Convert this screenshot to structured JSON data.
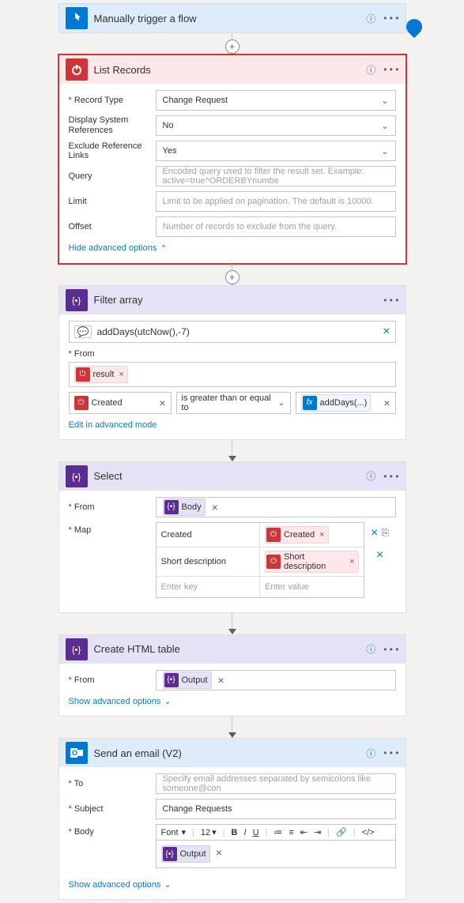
{
  "trigger": {
    "title": "Manually trigger a flow"
  },
  "listRecords": {
    "title": "List Records",
    "fields": {
      "recordType": {
        "label": "Record Type",
        "value": "Change Request"
      },
      "displaySystemRefs": {
        "label": "Display System References",
        "value": "No"
      },
      "excludeRefLinks": {
        "label": "Exclude Reference Links",
        "value": "Yes"
      },
      "query": {
        "label": "Query",
        "placeholder": "Encoded query used to filter the result set. Example: active=true^ORDERBYnumbe"
      },
      "limit": {
        "label": "Limit",
        "placeholder": "Limit to be applied on pagination. The default is 10000."
      },
      "offset": {
        "label": "Offset",
        "placeholder": "Number of records to exclude from the query."
      }
    },
    "hideAdvanced": "Hide advanced options"
  },
  "filterArray": {
    "title": "Filter array",
    "expression": "addDays(utcNow(),-7)",
    "fromLabel": "From",
    "fromToken": "result",
    "condLeft": "Created",
    "condOp": "is greater than or equal to",
    "condRight": "addDays(...)",
    "editLink": "Edit in advanced mode"
  },
  "select": {
    "title": "Select",
    "fromLabel": "From",
    "fromToken": "Body",
    "mapLabel": "Map",
    "rows": [
      {
        "key": "Created",
        "valToken": "Created"
      },
      {
        "key": "Short description",
        "valToken": "Short description"
      }
    ],
    "enterKey": "Enter key",
    "enterValue": "Enter value"
  },
  "createHtml": {
    "title": "Create HTML table",
    "fromLabel": "From",
    "fromToken": "Output",
    "showAdvanced": "Show advanced options"
  },
  "sendEmail": {
    "title": "Send an email (V2)",
    "toLabel": "To",
    "toPlaceholder": "Specify email addresses separated by semicolons like someone@con",
    "subjectLabel": "Subject",
    "subjectValue": "Change Requests",
    "bodyLabel": "Body",
    "fontLabel": "Font",
    "fontSize": "12",
    "bodyToken": "Output",
    "showAdvanced": "Show advanced options"
  }
}
